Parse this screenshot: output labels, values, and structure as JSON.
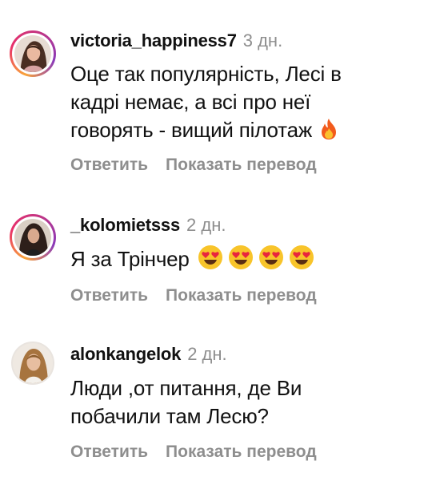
{
  "comments": [
    {
      "username": "victoria_happiness7",
      "time": "3 дн.",
      "lines": [
        "Оце так популярність, Лесі в",
        "кадрі немає, а всі про неї",
        "говорять - вищий пілотаж"
      ],
      "emoji": [
        "fire-emoji"
      ],
      "reply_label": "Ответить",
      "translate_label": "Показать перевод",
      "has_story_ring": true
    },
    {
      "username": "_kolomietsss",
      "time": "2 дн.",
      "lines": [
        "Я за Трінчер"
      ],
      "emoji": [
        "heart-eyes-emoji",
        "heart-eyes-emoji",
        "heart-eyes-emoji",
        "heart-eyes-emoji"
      ],
      "reply_label": "Ответить",
      "translate_label": "Показать перевод",
      "has_story_ring": true
    },
    {
      "username": "alonkangelok",
      "time": "2 дн.",
      "lines": [
        "Люди ,от питання, де Ви",
        "побачили там Лесю?"
      ],
      "emoji": [],
      "reply_label": "Ответить",
      "translate_label": "Показать перевод",
      "has_story_ring": false
    }
  ]
}
